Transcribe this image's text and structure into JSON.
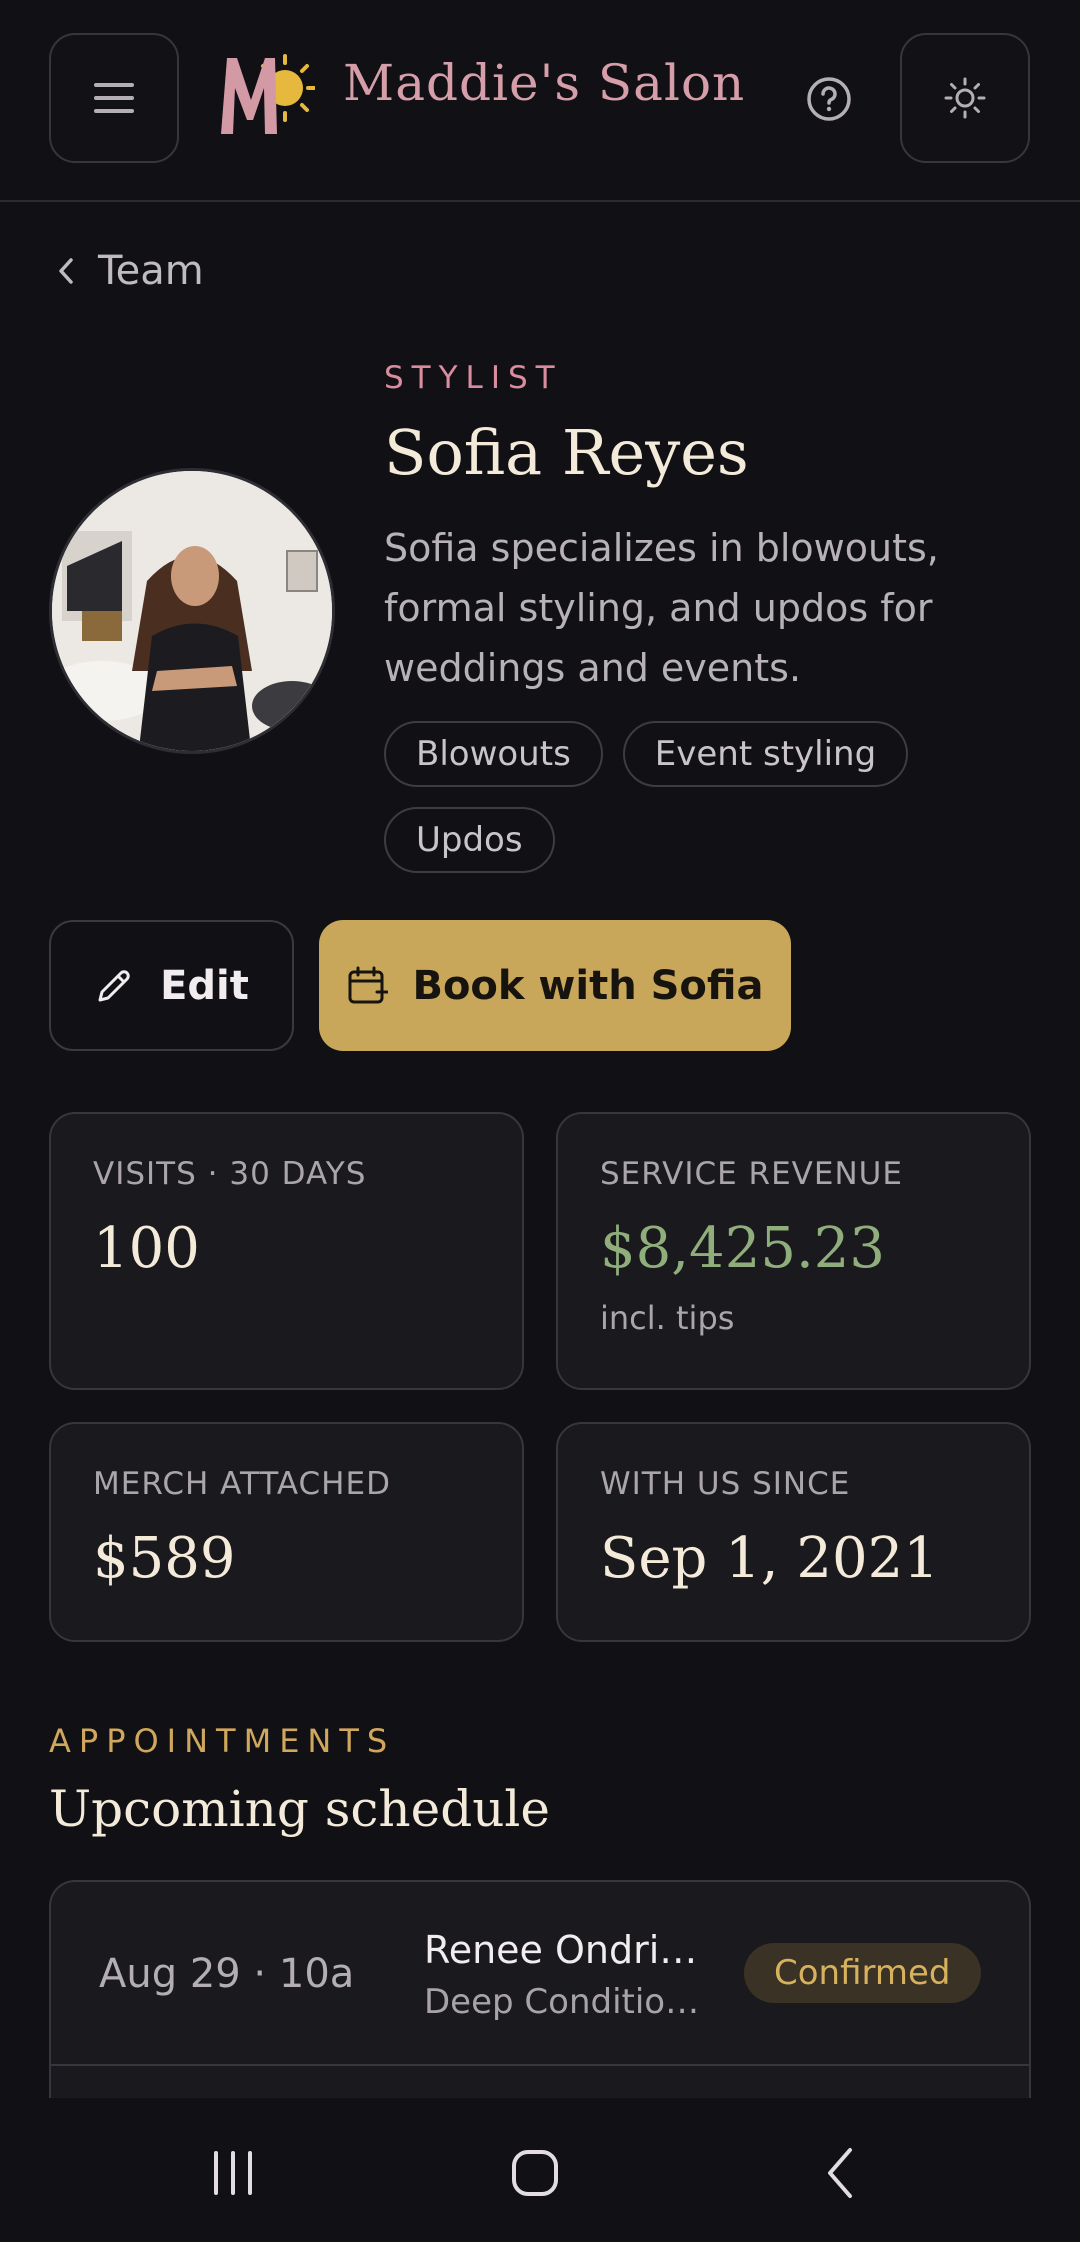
{
  "header": {
    "brand": "Maddie's Salon",
    "menu_icon": "hamburger-menu-icon",
    "help_icon": "question-circle-icon",
    "theme_icon": "sun-icon"
  },
  "breadcrumb": {
    "label": "Team"
  },
  "profile": {
    "role": "STYLIST",
    "name": "Sofia Reyes",
    "bio": "Sofia specializes in blowouts, formal styling, and updos for weddings and events.",
    "tags": [
      "Blowouts",
      "Event styling",
      "Updos"
    ]
  },
  "actions": {
    "edit_label": "Edit",
    "book_label": "Book with Sofia"
  },
  "stats": {
    "visits": {
      "label": "VISITS · 30 DAYS",
      "value": "100"
    },
    "revenue": {
      "label": "SERVICE REVENUE",
      "value": "$8,425.23",
      "note": "incl. tips"
    },
    "merch": {
      "label": "MERCH ATTACHED",
      "value": "$589"
    },
    "since": {
      "label": "WITH US SINCE",
      "value": "Sep 1, 2021"
    }
  },
  "appointments": {
    "kicker": "APPOINTMENTS",
    "title": "Upcoming schedule",
    "items": [
      {
        "date": "Aug 29 · 10a",
        "client": "Renee Ondri…",
        "service": "Deep Condition…",
        "status": "Confirmed"
      }
    ]
  },
  "colors": {
    "background": "#111014",
    "accent_gold": "#c9a75a",
    "accent_pink": "#d98d9e",
    "revenue_green": "#8fae7c"
  },
  "system_nav": {
    "recents_icon": "recents-icon",
    "home_icon": "home-icon",
    "back_icon": "back-icon"
  }
}
